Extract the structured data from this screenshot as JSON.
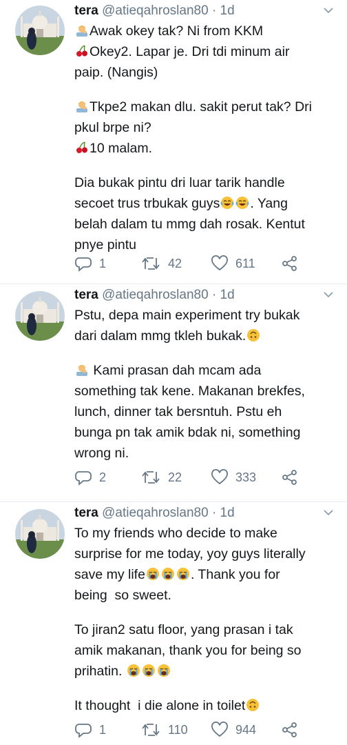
{
  "tweets": [
    {
      "author_name": "tera",
      "author_handle": "@atieqahroslan80",
      "separator": "·",
      "time": "1d",
      "lines": [
        {
          "emoji": "person-emoji",
          "text": "Awak okey tak? Ni from KKM"
        },
        {
          "emoji": "cherries-emoji",
          "text": "Okey2. Lapar je. Dri tdi minum air"
        },
        {
          "text": "paip. (Nangis)"
        },
        {
          "gap": true
        },
        {
          "emoji": "person-emoji",
          "text": "Tkpe2 makan dlu. sakit perut tak? Dri"
        },
        {
          "text": "pkul brpe ni?"
        },
        {
          "emoji": "cherries-emoji",
          "text": "10 malam."
        },
        {
          "gap": true
        },
        {
          "text": "Dia bukak pintu dri luar tarik handle"
        },
        {
          "text": "secoet trus trbukak guys",
          "emoji_after": [
            "joy-emoji",
            "joy-emoji"
          ],
          "text_after": ". Yang"
        },
        {
          "text": "belah dalam tu mmg dah rosak. Kentut"
        },
        {
          "text": "pnye pintu"
        }
      ],
      "replies": "1",
      "retweets": "42",
      "likes": "611"
    },
    {
      "author_name": "tera",
      "author_handle": "@atieqahroslan80",
      "separator": "·",
      "time": "1d",
      "lines": [
        {
          "text": "Pstu, depa main experiment try bukak"
        },
        {
          "text": "dari dalam mmg tkleh bukak.",
          "emoji_after": [
            "upside-down-emoji"
          ]
        },
        {
          "gap": true
        },
        {
          "emoji": "person-emoji",
          "text": " Kami prasan dah mcam ada"
        },
        {
          "text": "something tak kene. Makanan brekfes,"
        },
        {
          "text": "lunch, dinner tak bersntuh. Pstu eh"
        },
        {
          "text": "bunga pn tak amik bdak ni, something"
        },
        {
          "text": "wrong ni."
        }
      ],
      "replies": "2",
      "retweets": "22",
      "likes": "333"
    },
    {
      "author_name": "tera",
      "author_handle": "@atieqahroslan80",
      "separator": "·",
      "time": "1d",
      "lines": [
        {
          "text": "To my friends who decide to make"
        },
        {
          "text": "surprise for me today, yoy guys literally"
        },
        {
          "text": "save my life",
          "emoji_after": [
            "cry-emoji",
            "cry-emoji",
            "cry-emoji"
          ],
          "text_after": ". Thank you for"
        },
        {
          "text": "being  so sweet."
        },
        {
          "gap": true
        },
        {
          "text": "To jiran2 satu floor, yang prasan i tak"
        },
        {
          "text": "amik makanan, thank you for being so"
        },
        {
          "text": "prihatin. ",
          "emoji_after": [
            "cry-emoji",
            "cry-emoji",
            "cry-emoji"
          ]
        },
        {
          "gap": true
        },
        {
          "text": "It thought  i die alone in toilet",
          "emoji_after": [
            "upside-down-emoji"
          ]
        }
      ],
      "replies": "1",
      "retweets": "110",
      "likes": "944"
    }
  ],
  "colors": {
    "text": "#14171a",
    "muted": "#657786",
    "divider": "#e6ecf0"
  }
}
